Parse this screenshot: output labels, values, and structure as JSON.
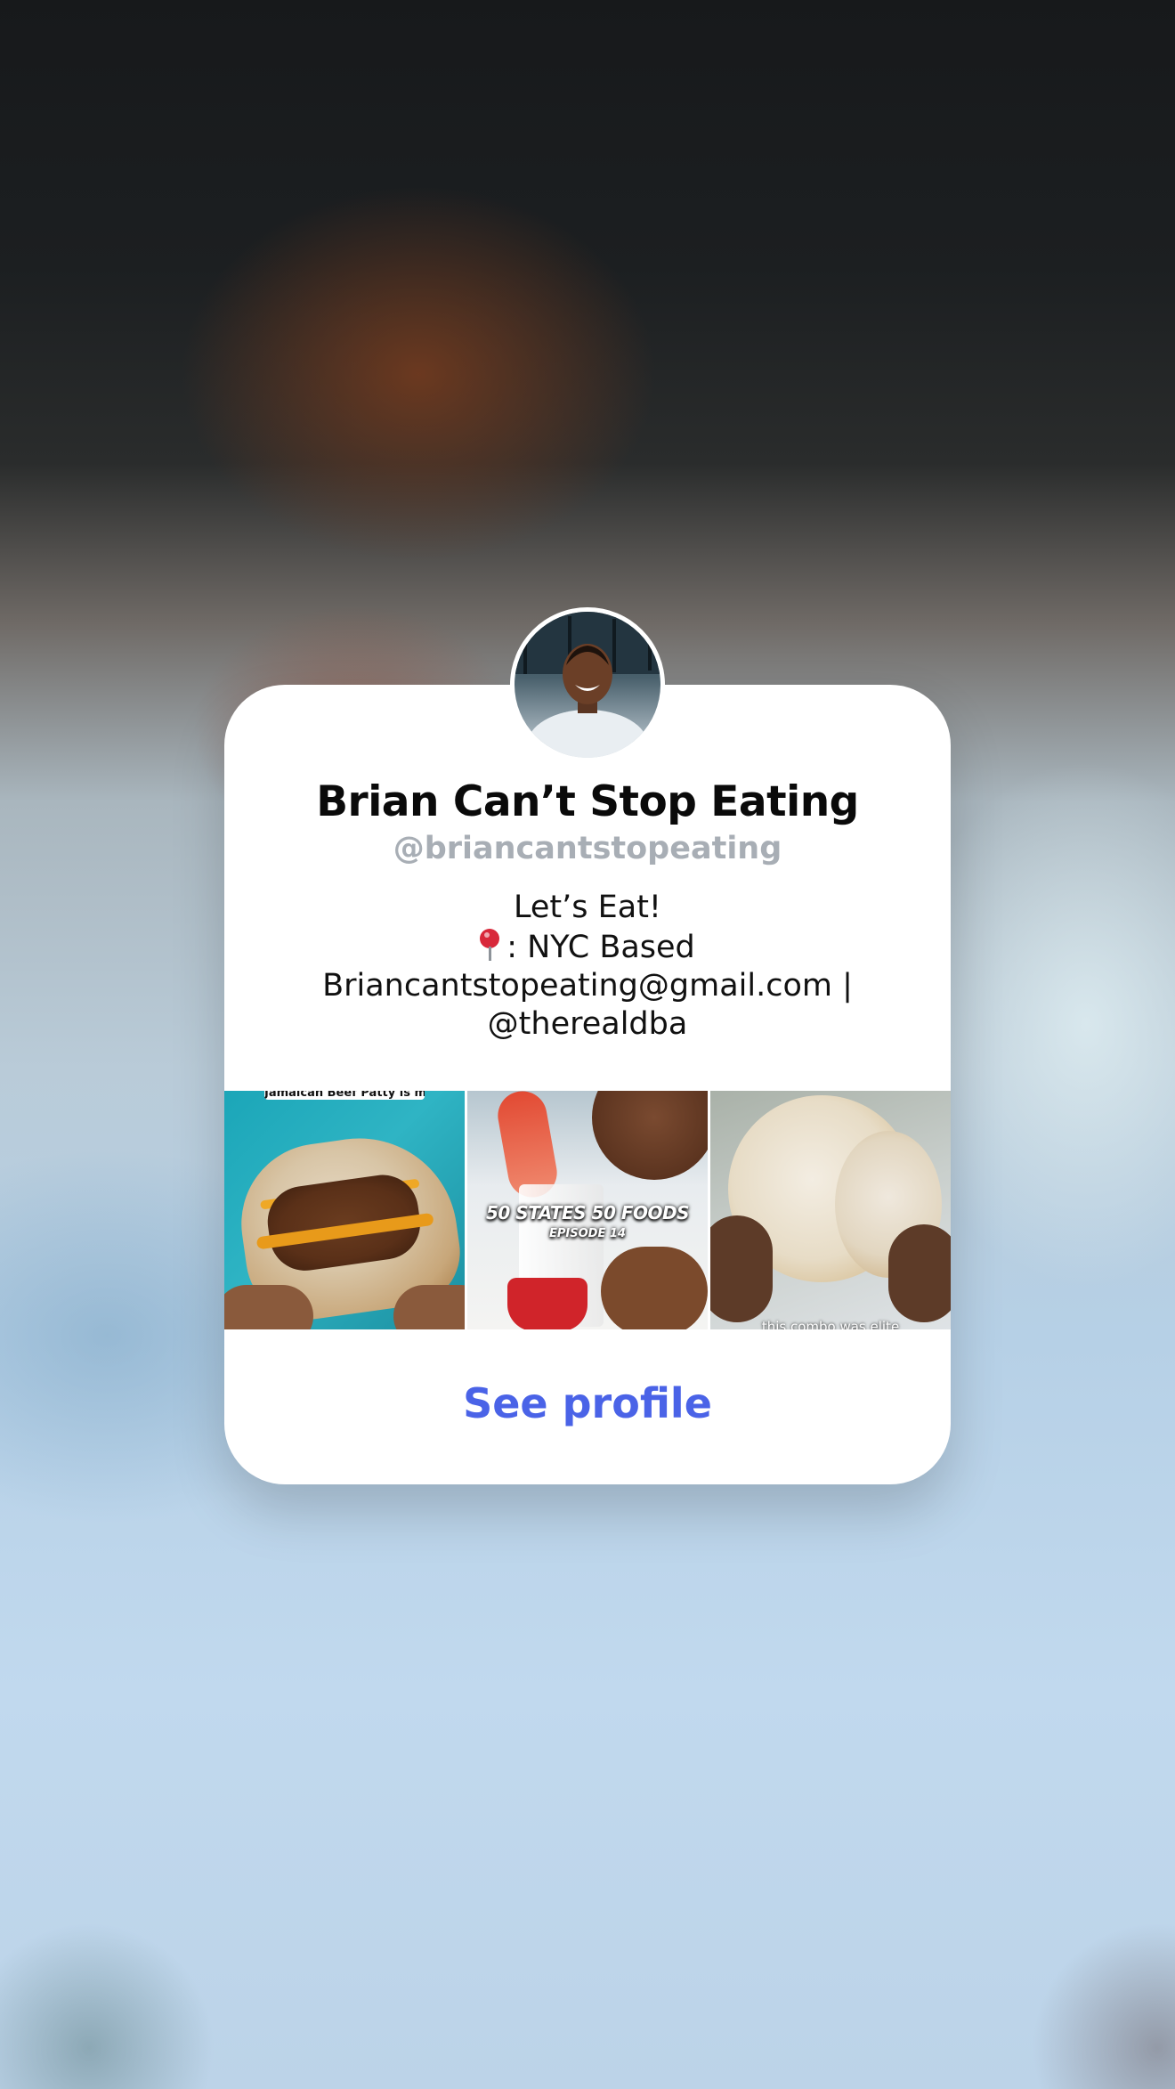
{
  "profile_card": {
    "display_name": "Brian Can’t Stop Eating",
    "username": "@briancantstopeating",
    "bio_lines": [
      "Let’s Eat!",
      ": NYC Based",
      "Briancantstopeating@gmail.com |",
      "@therealdba"
    ],
    "bio_pin_icon": "round-pushpin-icon",
    "thumbnails": [
      {
        "caption": "Jamaican Beef Patty is made"
      },
      {
        "title": "50 STATES 50 FOODS",
        "subtitle": "EPISODE 14"
      },
      {
        "caption": "this combo was elite"
      }
    ],
    "see_profile_label": "See profile"
  },
  "colors": {
    "accent": "#4a63e7",
    "handle_gray": "#a8aeb5",
    "card_bg": "#ffffff"
  }
}
